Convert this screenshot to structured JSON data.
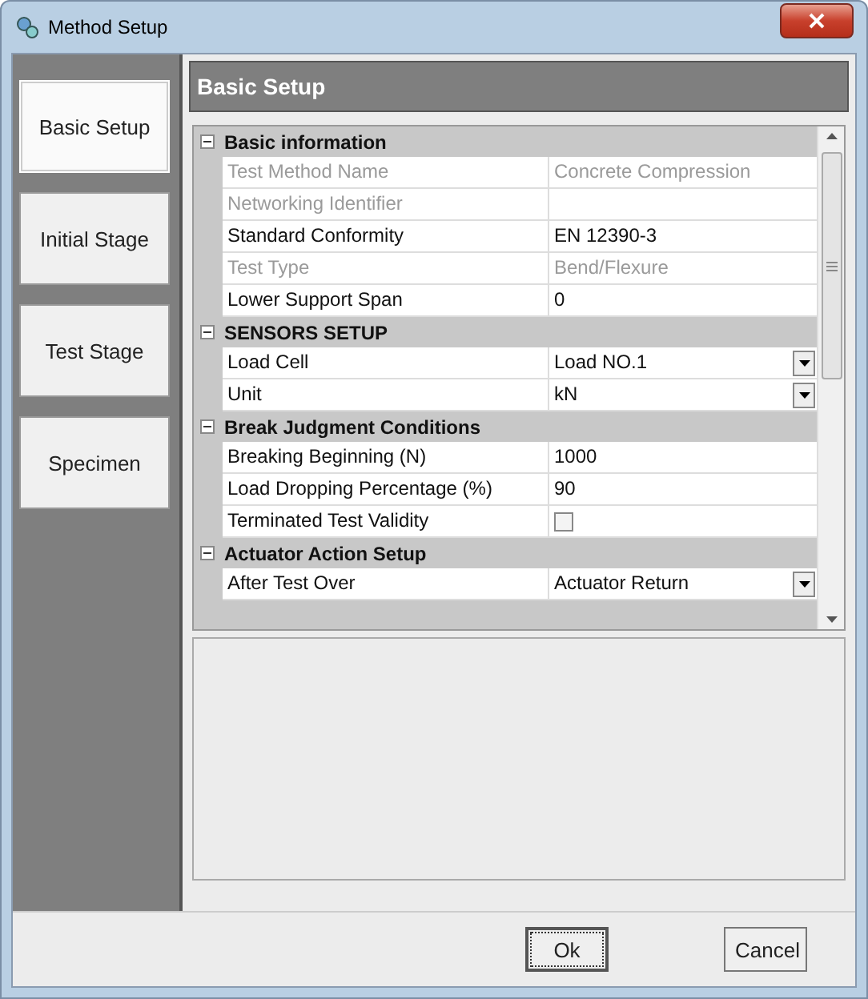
{
  "window": {
    "title": "Method Setup"
  },
  "sidebar": {
    "items": [
      {
        "label": "Basic Setup",
        "selected": true
      },
      {
        "label": "Initial Stage",
        "selected": false
      },
      {
        "label": "Test Stage",
        "selected": false
      },
      {
        "label": "Specimen",
        "selected": false
      }
    ]
  },
  "panel": {
    "title": "Basic Setup"
  },
  "property_grid": {
    "groups": [
      {
        "title": "Basic information",
        "expanded": true,
        "rows": [
          {
            "kind": "text",
            "name": "Test Method Name",
            "value": "Concrete Compression",
            "disabled": true
          },
          {
            "kind": "text",
            "name": "Networking Identifier",
            "disabled": true
          },
          {
            "kind": "text",
            "name": "Standard Conformity",
            "value": "EN 12390-3",
            "disabled": false
          },
          {
            "kind": "text",
            "name": "Test Type",
            "value": "Bend/Flexure",
            "disabled": true
          },
          {
            "kind": "text",
            "name": "Lower Support Span",
            "value": "0",
            "disabled": false
          }
        ]
      },
      {
        "title": "SENSORS SETUP",
        "expanded": true,
        "rows": [
          {
            "kind": "dropdown",
            "name": "Load Cell",
            "value": "Load NO.1",
            "disabled": false
          },
          {
            "kind": "dropdown",
            "name": "Unit",
            "value": "kN",
            "disabled": false
          }
        ]
      },
      {
        "title": "Break Judgment Conditions",
        "expanded": true,
        "rows": [
          {
            "kind": "text",
            "name": "Breaking Beginning (N)",
            "value": "1000",
            "disabled": false
          },
          {
            "kind": "text",
            "name": "Load Dropping Percentage (%)",
            "value": "90",
            "disabled": false
          },
          {
            "kind": "checkbox",
            "name": "Terminated Test Validity",
            "checked": false,
            "disabled": false
          }
        ]
      },
      {
        "title": "Actuator Action Setup",
        "expanded": true,
        "rows": [
          {
            "kind": "dropdown",
            "name": "After Test Over",
            "value": "Actuator Return",
            "disabled": false
          }
        ]
      }
    ]
  },
  "buttons": [
    {
      "label": "Ok",
      "kind": "default"
    },
    {
      "label": "Cancel",
      "kind": "normal"
    }
  ]
}
